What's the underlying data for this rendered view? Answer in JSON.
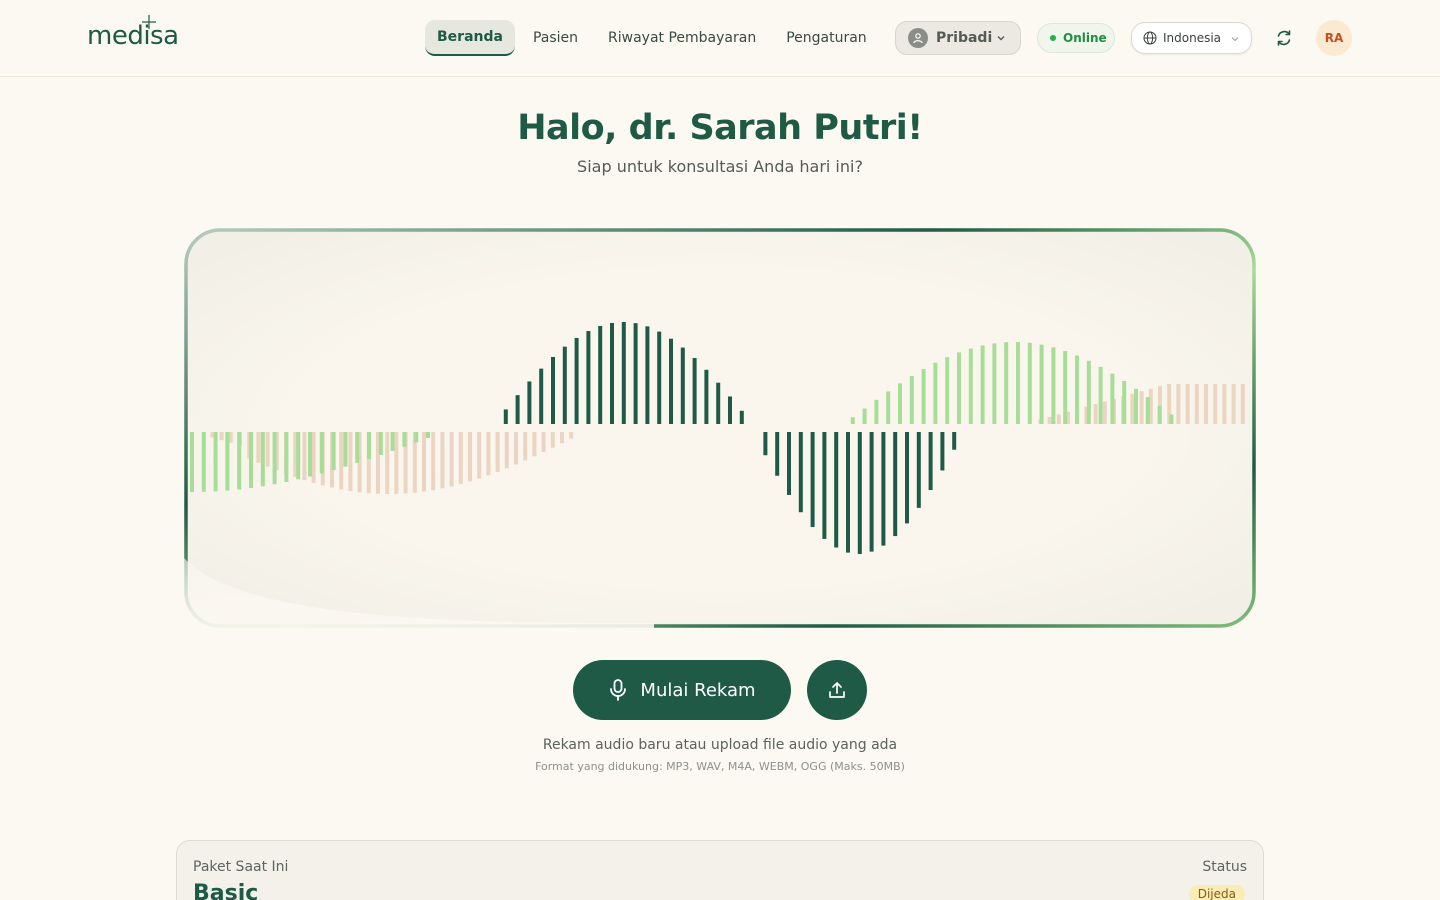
{
  "app": {
    "logo": "medisa"
  },
  "nav": {
    "items": [
      {
        "label": "Beranda",
        "active": true
      },
      {
        "label": "Pasien",
        "active": false
      },
      {
        "label": "Riwayat Pembayaran",
        "active": false
      },
      {
        "label": "Pengaturan",
        "active": false
      }
    ]
  },
  "header": {
    "mode_label": "Pribadi",
    "status_label": "Online",
    "language_label": "Indonesia",
    "avatar_initials": "RA"
  },
  "greeting": {
    "title": "Halo, dr. Sarah Putri!",
    "subtitle": "Siap untuk konsultasi Anda hari ini?"
  },
  "recorder": {
    "record_label": "Mulai Rekam",
    "hint": "Rekam audio baru atau upload file audio yang ada",
    "formats": "Format yang didukung: MP3, WAV, M4A, WEBM, OGG (Maks. 50MB)"
  },
  "plan": {
    "current_label": "Paket Saat Ini",
    "name": "Basic",
    "status_label": "Status",
    "status_value": "Dijeda"
  },
  "colors": {
    "primary": "#1e5a45",
    "light_green": "#a6dd97",
    "peach": "#ead3bf",
    "background": "#fcf8f2",
    "status_online": "#21b04b",
    "avatar_text": "#c2511c"
  }
}
